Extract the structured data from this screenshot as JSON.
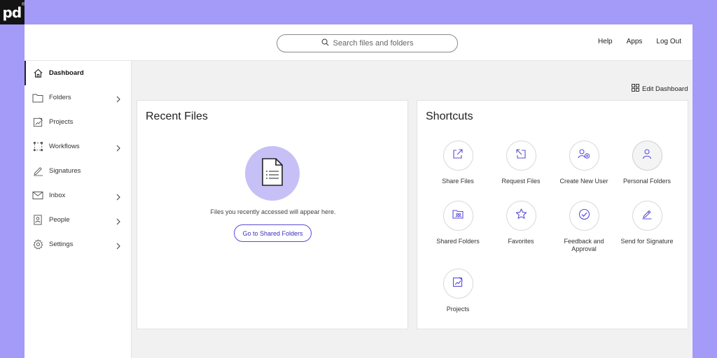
{
  "header": {
    "search_placeholder": "Search files and folders",
    "links": [
      "Help",
      "Apps",
      "Log Out"
    ]
  },
  "sidebar": {
    "items": [
      {
        "label": "Dashboard",
        "icon": "home-icon",
        "active": true,
        "has_chevron": false
      },
      {
        "label": "Folders",
        "icon": "folder-icon",
        "active": false,
        "has_chevron": true
      },
      {
        "label": "Projects",
        "icon": "projects-icon",
        "active": false,
        "has_chevron": false
      },
      {
        "label": "Workflows",
        "icon": "workflows-icon",
        "active": false,
        "has_chevron": true
      },
      {
        "label": "Signatures",
        "icon": "signature-icon",
        "active": false,
        "has_chevron": false
      },
      {
        "label": "Inbox",
        "icon": "inbox-icon",
        "active": false,
        "has_chevron": true
      },
      {
        "label": "People",
        "icon": "people-icon",
        "active": false,
        "has_chevron": true
      },
      {
        "label": "Settings",
        "icon": "settings-icon",
        "active": false,
        "has_chevron": true
      }
    ]
  },
  "dashboard": {
    "edit_label": "Edit Dashboard"
  },
  "recent_files": {
    "title": "Recent Files",
    "empty_text": "Files you recently accessed will appear here.",
    "button_label": "Go to Shared Folders"
  },
  "shortcuts": {
    "title": "Shortcuts",
    "items": [
      {
        "label": "Share Files",
        "icon": "share-files-icon"
      },
      {
        "label": "Request Files",
        "icon": "request-files-icon"
      },
      {
        "label": "Create New User",
        "icon": "add-user-icon"
      },
      {
        "label": "Personal Folders",
        "icon": "person-icon"
      },
      {
        "label": "Shared Folders",
        "icon": "shared-folders-icon"
      },
      {
        "label": "Favorites",
        "icon": "star-icon"
      },
      {
        "label": "Feedback and Approval",
        "icon": "check-circle-icon"
      },
      {
        "label": "Send for Signature",
        "icon": "pen-icon"
      },
      {
        "label": "Projects",
        "icon": "projects-icon"
      }
    ]
  },
  "colors": {
    "background": "#a39bf7",
    "accent": "#5b4bd8",
    "empty_circle": "#c6c0f6",
    "logo_bg": "#141414"
  }
}
